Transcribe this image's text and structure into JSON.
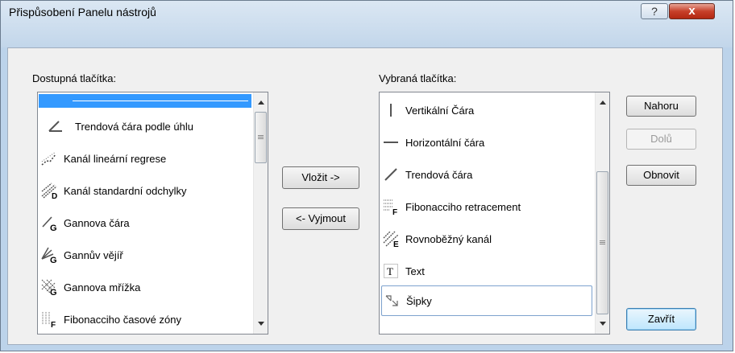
{
  "window": {
    "title": "Přispůsobení Panelu nástrojů",
    "help_label": "?",
    "close_label": "x"
  },
  "available": {
    "label": "Dostupná tlačítka:",
    "items": [
      {
        "label": "",
        "icon": "separator-line"
      },
      {
        "label": "Trendová čára podle úhlu",
        "icon": "angle-icon"
      },
      {
        "label": "Kanál lineární regrese",
        "icon": "regression-channel-icon"
      },
      {
        "label": "Kanál standardní odchylky",
        "icon": "std-deviation-channel-icon"
      },
      {
        "label": "Gannova čára",
        "icon": "gann-line-icon"
      },
      {
        "label": "Gannův vějíř",
        "icon": "gann-fan-icon"
      },
      {
        "label": "Gannova mřížka",
        "icon": "gann-grid-icon"
      },
      {
        "label": "Fibonacciho časové zóny",
        "icon": "fibonacci-timezones-icon"
      }
    ]
  },
  "selected": {
    "label": "Vybraná tlačítka:",
    "items": [
      {
        "label": "Vertikální Čára",
        "icon": "vertical-line-icon"
      },
      {
        "label": "Horizontální čára",
        "icon": "horizontal-line-icon"
      },
      {
        "label": "Trendová čára",
        "icon": "trendline-icon"
      },
      {
        "label": "Fibonacciho retracement",
        "icon": "fibonacci-retracement-icon"
      },
      {
        "label": "Rovnoběžný kanál",
        "icon": "parallel-channel-icon"
      },
      {
        "label": "Text",
        "icon": "text-icon"
      },
      {
        "label": "Šipky",
        "icon": "arrows-icon"
      }
    ]
  },
  "buttons": {
    "insert": "Vložit ->",
    "remove": "<- Vyjmout",
    "up": "Nahoru",
    "down": "Dolů",
    "reset": "Obnovit",
    "close": "Zavřít"
  }
}
